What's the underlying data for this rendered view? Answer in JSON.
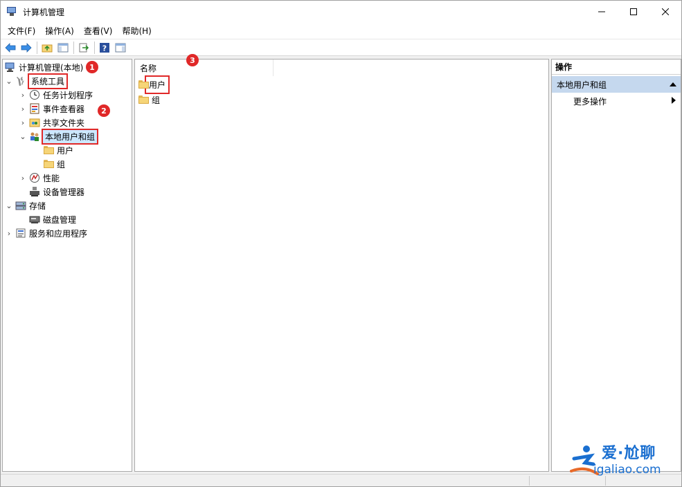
{
  "window": {
    "title": "计算机管理",
    "controls": {
      "minimize": "—",
      "maximize": "☐",
      "close": "✕"
    }
  },
  "menu": [
    "文件(F)",
    "操作(A)",
    "查看(V)",
    "帮助(H)"
  ],
  "toolbar": {
    "icons": [
      "back-arrow-icon",
      "forward-arrow-icon",
      "up-folder-icon",
      "show-hide-tree-icon",
      "export-list-icon",
      "help-icon",
      "show-hide-action-pane-icon"
    ]
  },
  "tree": {
    "root": "计算机管理(本地)",
    "system_tools": "系统工具",
    "task_scheduler": "任务计划程序",
    "event_viewer": "事件查看器",
    "shared_folders": "共享文件夹",
    "local_users_groups": "本地用户和组",
    "users": "用户",
    "groups": "组",
    "performance": "性能",
    "device_manager": "设备管理器",
    "storage": "存储",
    "disk_management": "磁盘管理",
    "services_apps": "服务和应用程序"
  },
  "list": {
    "column_name": "名称",
    "rows": [
      "用户",
      "组"
    ]
  },
  "actions": {
    "header": "操作",
    "group": "本地用户和组",
    "more": "更多操作"
  },
  "badges": {
    "one": "1",
    "two": "2",
    "three": "3"
  },
  "watermark": {
    "top": "爱·尬聊",
    "bottom": "igaliao.com"
  },
  "colors": {
    "highlight": "#e02828",
    "action_group_bg": "#c5d8ee",
    "watermark": "#1a6fd0"
  }
}
